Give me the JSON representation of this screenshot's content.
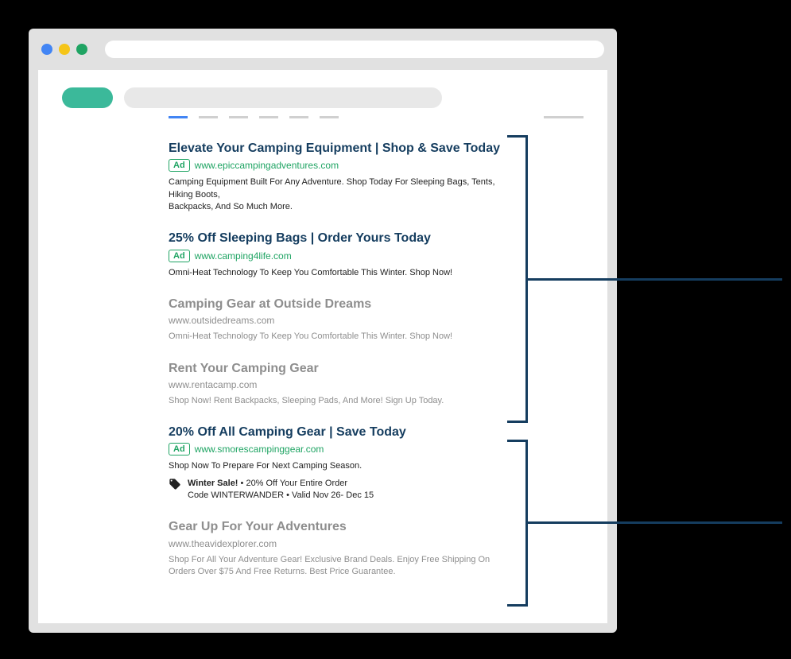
{
  "ad_badge_label": "Ad",
  "results": [
    {
      "title": "Elevate Your Camping Equipment | Shop & Save Today",
      "url": "www.epiccampingadventures.com",
      "desc": "Camping Equipment Built For Any Adventure. Shop Today For Sleeping Bags, Tents, Hiking Boots,\nBackpacks, And So Much More.",
      "is_ad": true,
      "faded": false
    },
    {
      "title": "25% Off Sleeping Bags | Order Yours Today",
      "url": "www.camping4life.com",
      "desc": "Omni-Heat Technology To Keep You Comfortable This Winter. Shop Now!",
      "is_ad": true,
      "faded": false
    },
    {
      "title": "Camping Gear at Outside Dreams",
      "url": "www.outsidedreams.com",
      "desc": "Omni-Heat Technology To Keep You Comfortable This Winter. Shop Now!",
      "is_ad": false,
      "faded": true
    },
    {
      "title": "Rent Your Camping Gear",
      "url": "www.rentacamp.com",
      "desc": "Shop Now! Rent Backpacks, Sleeping Pads, And More! Sign Up Today.",
      "is_ad": false,
      "faded": true
    },
    {
      "title": "20% Off All Camping Gear | Save Today",
      "url": "www.smorescampinggear.com",
      "desc": "Shop Now To Prepare For Next Camping Season.",
      "is_ad": true,
      "faded": false,
      "promo": {
        "headline": "Winter Sale!",
        "line1": " • 20% Off Your Entire Order",
        "line2": "Code WINTERWANDER • Valid Nov 26- Dec 15"
      }
    },
    {
      "title": "Gear Up For Your Adventures",
      "url": "www.theavidexplorer.com",
      "desc": "Shop For All Your Adventure Gear! Exclusive Brand Deals. Enjoy Free Shipping On Orders Over $75 And Free Returns. Best Price Guarantee.",
      "is_ad": false,
      "faded": true
    }
  ],
  "colors": {
    "title_active": "#153d5f",
    "ad_green": "#1fa463",
    "faded": "#8e8e8e",
    "logo": "#3bb99a",
    "bracket": "#153d5f"
  }
}
